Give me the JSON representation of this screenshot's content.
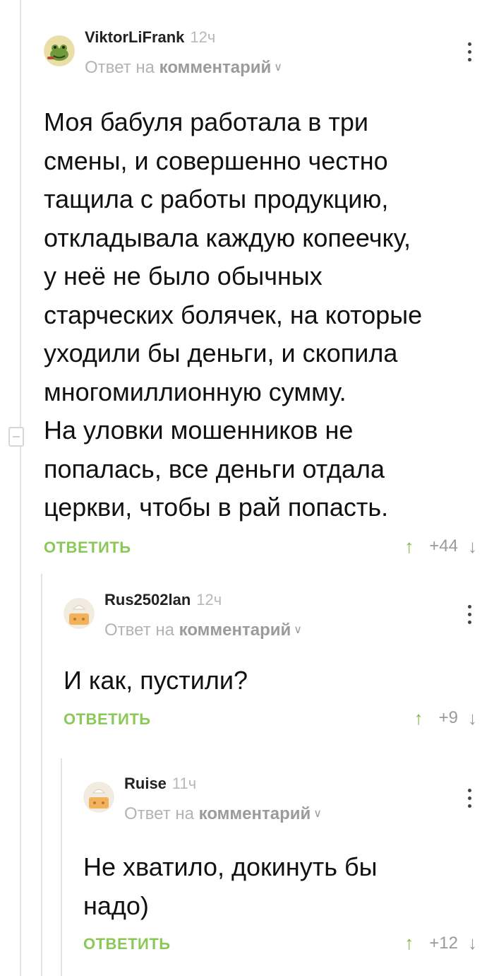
{
  "labels": {
    "reply_to_prefix": "Ответ на",
    "reply_to_link": "комментарий",
    "reply_button": "ОТВЕТИТЬ"
  },
  "icons": {
    "more": "more-vertical-icon",
    "upvote": "arrow-up-icon",
    "downvote": "arrow-down-icon",
    "chevron": "chevron-down-icon",
    "collapse": "collapse-thread-icon"
  },
  "colors": {
    "accent_green": "#8ac858",
    "thread_line": "#e3e3e3",
    "muted_text": "#b3b3b3"
  },
  "comments": [
    {
      "username": "ViktorLiFrank",
      "time": "12ч",
      "text": "Моя бабуля работала в три\nсмены, и совершенно честно\nтащила с работы продукцию,\nоткладывала каждую копеечку,\nу неё не было обычных\nстарческих болячек, на которые\nуходили бы деньги, и скопила\nмногомиллионную сумму.\nНа уловки мошенников не\nпопалась, все деньги отдала\nцеркви, чтобы в рай попасть.",
      "rating": "+44"
    },
    {
      "username": "Rus2502lan",
      "time": "12ч",
      "text": "И как, пустили?",
      "rating": "+9"
    },
    {
      "username": "Ruise",
      "time": "11ч",
      "text": "Не хватило, докинуть бы\nнадо)",
      "rating": "+12"
    }
  ]
}
